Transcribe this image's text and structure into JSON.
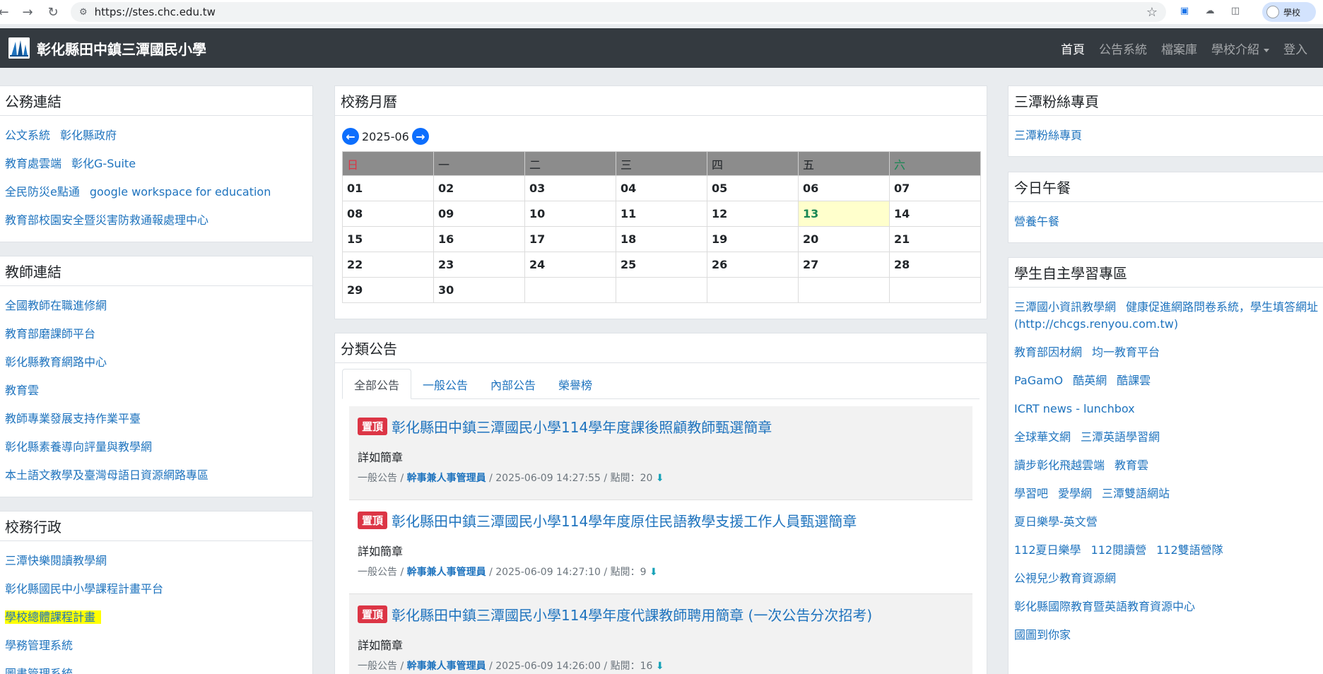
{
  "browser": {
    "url": "https://stes.chc.edu.tw",
    "profile_label": "學校"
  },
  "navbar": {
    "title": "彰化縣田中鎮三潭國民小學",
    "links": [
      {
        "label": "首頁",
        "active": true
      },
      {
        "label": "公告系統"
      },
      {
        "label": "檔案庫"
      },
      {
        "label": "學校介紹"
      },
      {
        "label": "登入"
      }
    ]
  },
  "left": {
    "official": {
      "title": "公務連結",
      "rows": [
        [
          "公文系統",
          "彰化縣政府"
        ],
        [
          "教育處雲端",
          "彰化G-Suite"
        ],
        [
          "全民防災e點通",
          "google workspace for education"
        ],
        [
          "教育部校園安全暨災害防救通報處理中心"
        ]
      ]
    },
    "teacher": {
      "title": "教師連結",
      "rows": [
        [
          "全國教師在職進修網"
        ],
        [
          "教育部磨課師平台"
        ],
        [
          "彰化縣教育網路中心"
        ],
        [
          "教育雲"
        ],
        [
          "教師專業發展支持作業平臺"
        ],
        [
          "彰化縣素養導向評量與教學網"
        ],
        [
          "本土語文教學及臺灣母語日資源網路專區"
        ]
      ]
    },
    "admin": {
      "title": "校務行政",
      "rows": [
        [
          "三潭快樂閱讀教學網"
        ],
        [
          "彰化縣國民中小學課程計畫平台"
        ],
        [
          "學校總體課程計畫"
        ],
        [
          "學務管理系統"
        ],
        [
          "圖書管理系統"
        ]
      ]
    }
  },
  "calendar": {
    "title": "校務月曆",
    "month": "2025-06",
    "weekdays": [
      "日",
      "一",
      "二",
      "三",
      "四",
      "五",
      "六"
    ],
    "weeks": [
      [
        "01",
        "02",
        "03",
        "04",
        "05",
        "06",
        "07"
      ],
      [
        "08",
        "09",
        "10",
        "11",
        "12",
        "13",
        "14"
      ],
      [
        "15",
        "16",
        "17",
        "18",
        "19",
        "20",
        "21"
      ],
      [
        "22",
        "23",
        "24",
        "25",
        "26",
        "27",
        "28"
      ],
      [
        "29",
        "30",
        "",
        "",
        "",
        "",
        ""
      ]
    ],
    "today": "13"
  },
  "announcements": {
    "title": "分類公告",
    "tabs": [
      "全部公告",
      "一般公告",
      "內部公告",
      "榮譽榜"
    ],
    "items": [
      {
        "badge": "置頂",
        "title": "彰化縣田中鎮三潭國民小學114學年度課後照顧教師甄選簡章",
        "summary": "詳如簡章",
        "category": "一般公告",
        "author": "幹事兼人事管理員",
        "datetime": "2025-06-09 14:27:55",
        "clicks_label": "點閱：20"
      },
      {
        "badge": "置頂",
        "title": "彰化縣田中鎮三潭國民小學114學年度原住民語教學支援工作人員甄選簡章",
        "summary": "詳如簡章",
        "category": "一般公告",
        "author": "幹事兼人事管理員",
        "datetime": "2025-06-09 14:27:10",
        "clicks_label": "點閱：9"
      },
      {
        "badge": "置頂",
        "title": "彰化縣田中鎮三潭國民小學114學年度代課教師聘用簡章 (一次公告分次招考)",
        "summary": "詳如簡章",
        "category": "一般公告",
        "author": "幹事兼人事管理員",
        "datetime": "2025-06-09 14:26:00",
        "clicks_label": "點閱：16"
      }
    ]
  },
  "right": {
    "fans": {
      "title": "三潭粉絲專頁",
      "rows": [
        [
          "三潭粉絲專頁"
        ]
      ]
    },
    "lunch": {
      "title": "今日午餐",
      "rows": [
        [
          "營養午餐"
        ]
      ]
    },
    "student": {
      "title": "學生自主學習專區",
      "rows": [
        [
          "三潭國小資訊教學網",
          "健康促進網路問卷系統，學生填答網址(http://chcgs.renyou.com.tw)"
        ],
        [
          "教育部因材網",
          "均一教育平台"
        ],
        [
          "PaGamO",
          "酷英網",
          "酷課雲"
        ],
        [
          "ICRT news - lunchbox"
        ],
        [
          "全球華文網",
          "三潭英語學習網"
        ],
        [
          "讀步彰化飛越雲端",
          "教育雲"
        ],
        [
          "學習吧",
          "愛學網",
          "三潭雙語網站"
        ],
        [
          "夏日樂學-英文營"
        ],
        [
          "112夏日樂學",
          "112閱讀營",
          "112雙語營隊"
        ],
        [
          "公視兒少教育資源網"
        ],
        [
          "彰化縣國際教育暨英語教育資源中心"
        ],
        [
          "國圖到你家"
        ]
      ]
    }
  }
}
